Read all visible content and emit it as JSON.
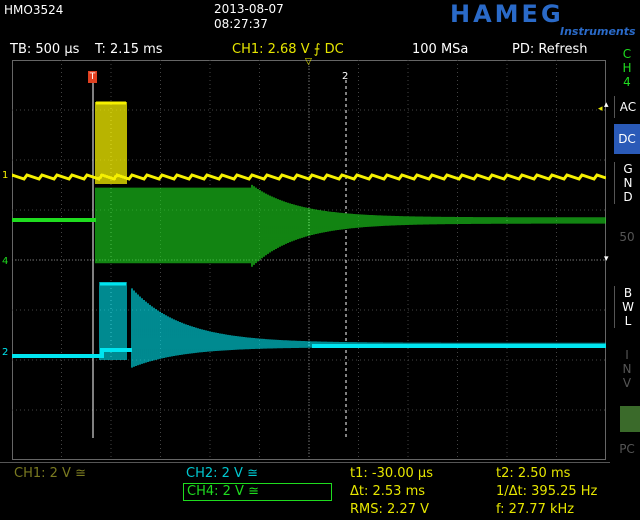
{
  "header": {
    "model": "HMO3524",
    "date": "2013-08-07",
    "time": "08:27:37",
    "brand": "HAMEG",
    "brand_sub": "Instruments"
  },
  "status_bar": {
    "timebase": "TB: 500 µs",
    "trigger_time": "T: 2.15 ms",
    "trigger": "CH1: 2.68 V",
    "trigger_coupling": "DC",
    "sample_rate": "100 MSa",
    "mode": "PD: Refresh"
  },
  "side_menu": {
    "channel": [
      "C",
      "H",
      "4"
    ],
    "ac": "AC",
    "dc": "DC",
    "gnd": [
      "G",
      "N",
      "D"
    ],
    "fifty": "50",
    "bwl": [
      "B",
      "W",
      "L"
    ],
    "inv": [
      "I",
      "N",
      "V"
    ],
    "pc": "PC"
  },
  "markers": {
    "ch1": "1",
    "ch4": "4",
    "ch2": "2",
    "trigger_flag": "T",
    "cursor2": "2"
  },
  "bottom": {
    "ch1": "CH1: 2 V ≅",
    "ch2": "CH2: 2 V ≅",
    "ch4": "CH4: 2 V ≅",
    "t1": "t1: -30.00 µs",
    "t2": "t2: 2.50 ms",
    "dt": "Δt: 2.53 ms",
    "inv_dt": "1/Δt: 395.25 Hz",
    "rms": "RMS: 2.27 V",
    "freq": "f: 27.77 kHz"
  },
  "colors": {
    "ch1": "#f5f000",
    "ch2": "#00e5f0",
    "ch4": "#1fdc1f",
    "accent": "#2a6ac8",
    "status_yellow": "#e6e600"
  }
}
